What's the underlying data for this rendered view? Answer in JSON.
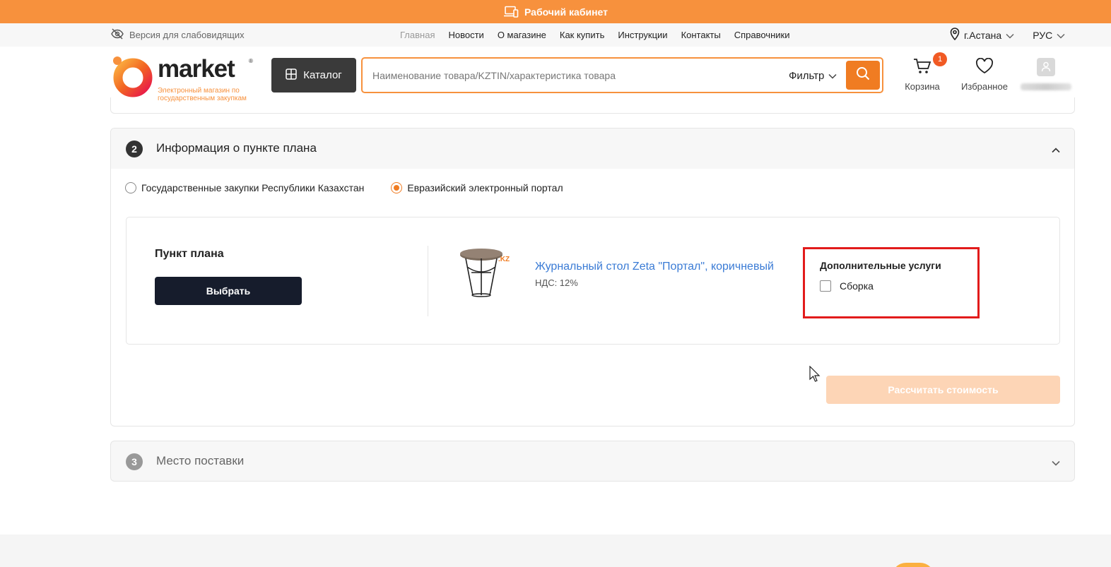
{
  "topbar": {
    "label": "Рабочий кабинет",
    "icon": "devices-icon"
  },
  "utility": {
    "accessibility": "Версия для слабовидящих",
    "nav": [
      "Главная",
      "Новости",
      "О магазине",
      "Как купить",
      "Инструкции",
      "Контакты",
      "Справочники"
    ],
    "city": "г.Астана",
    "language": "РУС"
  },
  "header": {
    "logo_text": "market",
    "logo_reg": "®",
    "logo_subtitle": "Электронный магазин по государственным закупкам",
    "catalog_label": "Каталог",
    "search_placeholder": "Наименование товара/KZTIN/характеристика товара",
    "filter_label": "Фильтр",
    "cart_label": "Корзина",
    "cart_count": "1",
    "favorites_label": "Избранное"
  },
  "section2": {
    "number": "2",
    "title": "Информация о пункте плана",
    "radio_options": [
      "Государственные закупки Республики Казахстан",
      "Евразийский электронный портал"
    ],
    "selected_radio": 1,
    "plan_item_label": "Пункт плана",
    "choose_button": "Выбрать",
    "product_name": "Журнальный стол Zeta \"Портал\", коричневый",
    "product_vat": "НДС: 12%",
    "product_badge": ".KZ",
    "services_title": "Дополнительные услуги",
    "services": [
      {
        "label": "Сборка",
        "checked": false
      }
    ],
    "calculate_button": "Рассчитать стоимость"
  },
  "section3": {
    "number": "3",
    "title": "Место поставки"
  },
  "colors": {
    "brand_orange": "#f7913d",
    "accent_button": "#f07c22",
    "link_blue": "#3a7bd5",
    "highlight_red": "#e21b1b"
  }
}
